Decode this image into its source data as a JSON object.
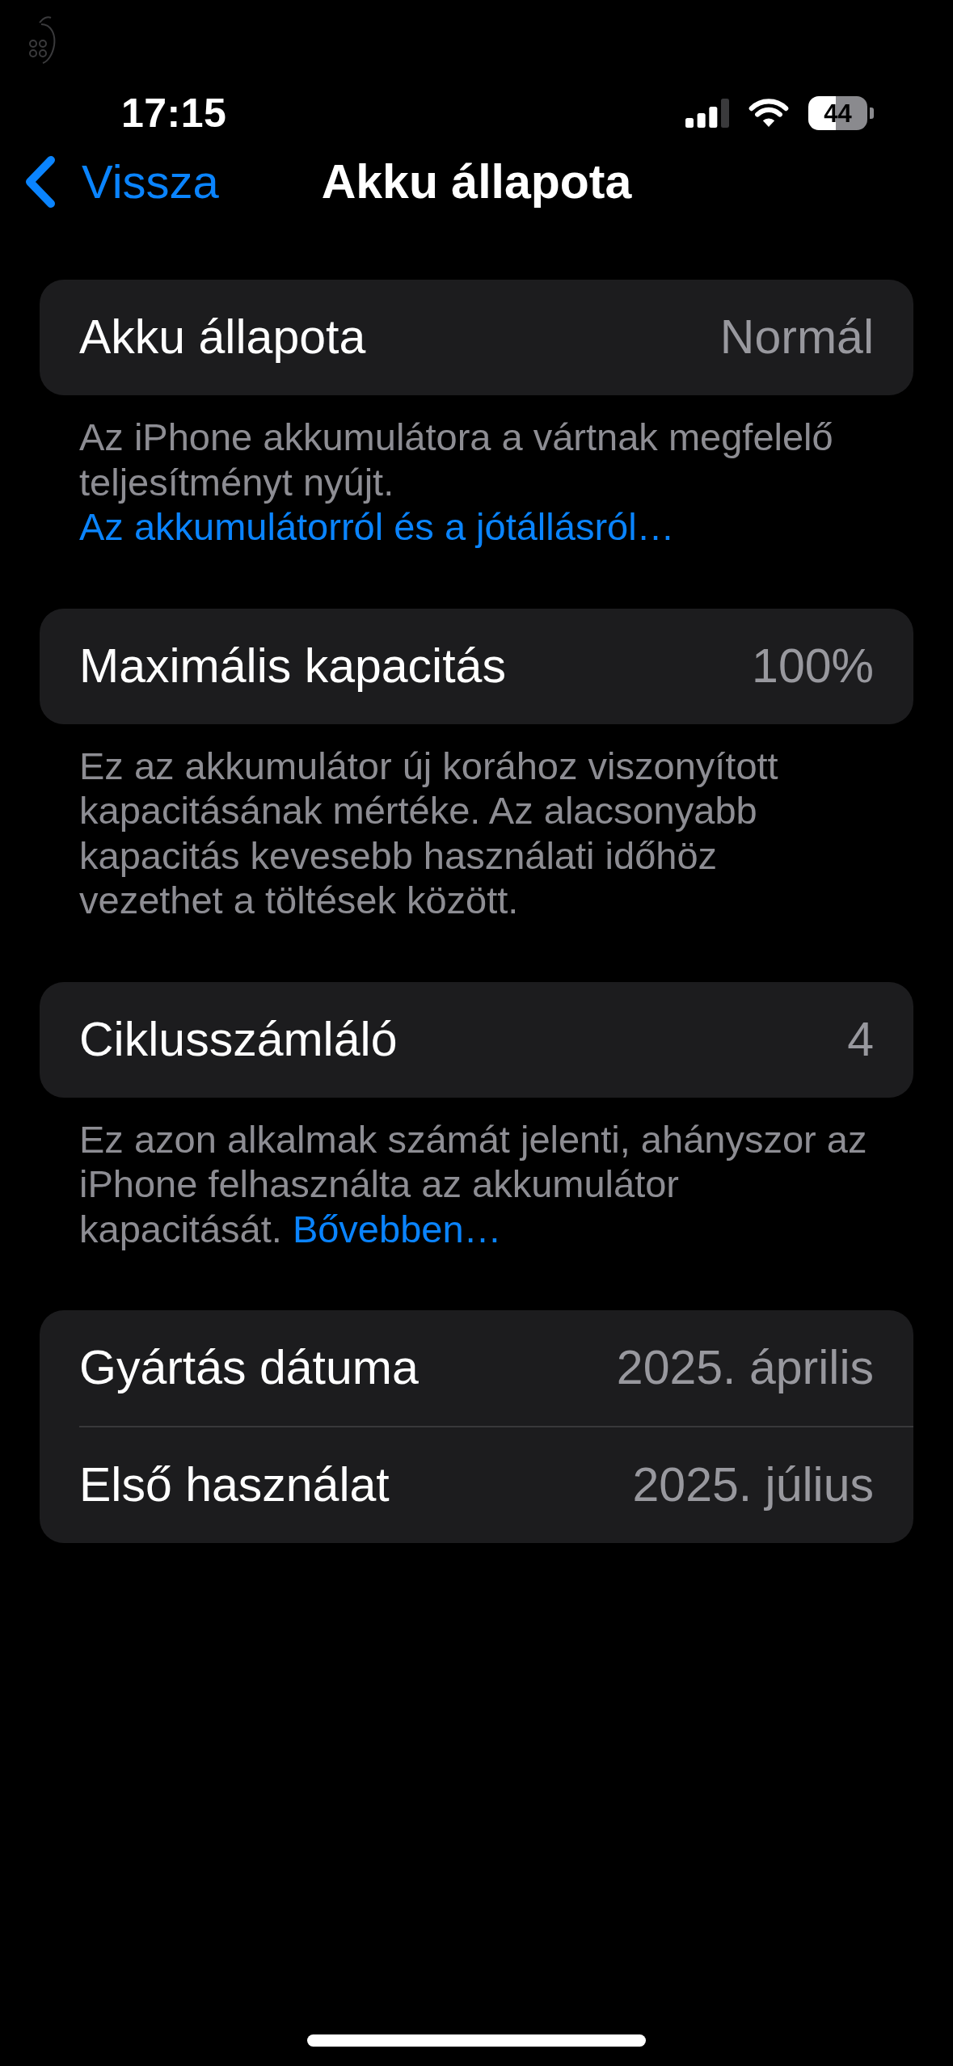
{
  "status_bar": {
    "time": "17:15",
    "battery": "44"
  },
  "nav": {
    "back_label": "Vissza",
    "title": "Akku állapota"
  },
  "sections": [
    {
      "rows": [
        {
          "label": "Akku állapota",
          "value": "Normál"
        }
      ],
      "footer": {
        "text": "Az iPhone akkumulátora a vártnak megfelelő teljesítményt nyújt.",
        "link": "Az akkumulátorról és a jótállásról…"
      }
    },
    {
      "rows": [
        {
          "label": "Maximális kapacitás",
          "value": "100%"
        }
      ],
      "footer": {
        "text": "Ez az akkumulátor új korához viszonyított kapacitásának mértéke. Az alacsonyabb kapacitás kevesebb használati időhöz vezethet a töltések között."
      }
    },
    {
      "rows": [
        {
          "label": "Ciklusszámláló",
          "value": "4"
        }
      ],
      "footer": {
        "text": "Ez azon alkalmak számát jelenti, ahányszor az iPhone felhasználta az akkumulátor kapacitását.",
        "link": "Bővebben…"
      }
    },
    {
      "rows": [
        {
          "label": "Gyártás dátuma",
          "value": "2025. április"
        },
        {
          "label": "Első használat",
          "value": "2025. július"
        }
      ]
    }
  ]
}
